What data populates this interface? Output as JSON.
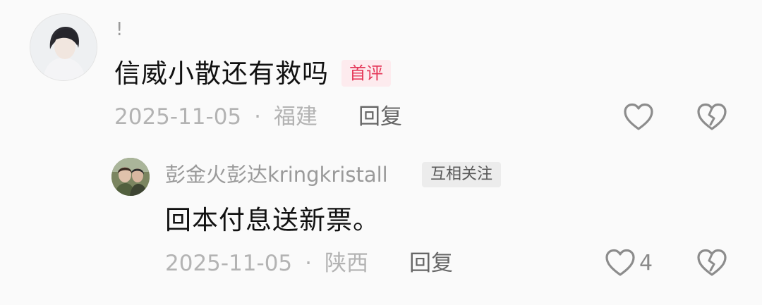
{
  "comment": {
    "username": "!",
    "text": "信威小散还有救吗",
    "badge": "首评",
    "date": "2025-11-05",
    "separator": "·",
    "location": "福建",
    "reply_label": "回复",
    "like_icon": "heart-outline-icon",
    "dislike_icon": "broken-heart-icon"
  },
  "reply": {
    "username": "彭金火彭达kringkristall",
    "badge": "互相关注",
    "text": "回本付息送新票。",
    "date": "2025-11-05",
    "separator": "·",
    "location": "陕西",
    "reply_label": "回复",
    "like_count": "4",
    "like_icon": "heart-outline-icon",
    "dislike_icon": "broken-heart-icon"
  },
  "colors": {
    "background": "#fafafa",
    "badge_first_bg": "#fdebee",
    "badge_first_text": "#e5395a",
    "badge_follow_bg": "#ececec",
    "meta_text": "#b3b3b3",
    "icon_stroke": "#8c8c8c"
  }
}
